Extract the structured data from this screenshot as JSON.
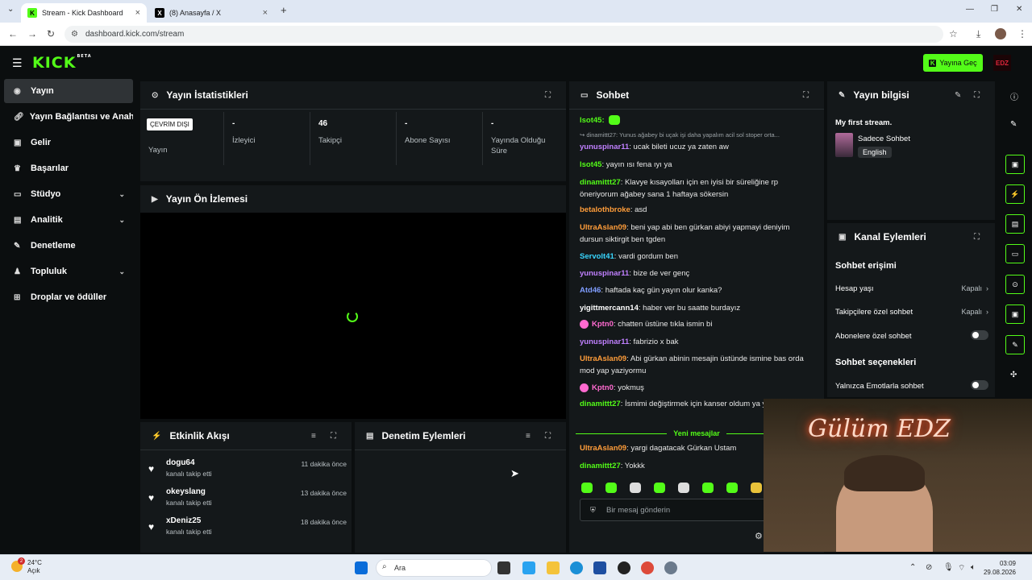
{
  "browser": {
    "tabs": [
      {
        "title": "Stream - Kick Dashboard",
        "active": true
      },
      {
        "title": "(8) Anasayfa / X",
        "active": false
      }
    ],
    "url": "dashboard.kick.com/stream"
  },
  "header": {
    "logo": "KICK",
    "logo_sup": "BETA",
    "go_live_label": "Yayına Geç",
    "avatar_text": "EDZ",
    "accent": "#53fc18"
  },
  "sidebar": {
    "items": [
      {
        "label": "Yayın",
        "icon": "video-icon",
        "active": true
      },
      {
        "label": "Yayın Bağlantısı ve Anahtarı",
        "icon": "link-icon"
      },
      {
        "label": "Gelir",
        "icon": "wallet-icon"
      },
      {
        "label": "Başarılar",
        "icon": "trophy-icon"
      },
      {
        "label": "Stüdyo",
        "icon": "studio-icon",
        "expandable": true
      },
      {
        "label": "Analitik",
        "icon": "chart-icon",
        "expandable": true
      },
      {
        "label": "Denetleme",
        "icon": "wrench-icon"
      },
      {
        "label": "Topluluk",
        "icon": "users-icon",
        "expandable": true
      },
      {
        "label": "Droplar ve ödüller",
        "icon": "gift-icon"
      }
    ]
  },
  "stats": {
    "title": "Yayın İstatistikleri",
    "offline_badge": "ÇEVRİM DIŞI",
    "items": [
      {
        "value": "",
        "label": "Yayın"
      },
      {
        "value": "-",
        "label": "İzleyici"
      },
      {
        "value": "46",
        "label": "Takipçi"
      },
      {
        "value": "-",
        "label": "Abone Sayısı"
      },
      {
        "value": "-",
        "label": "Yayında Olduğu Süre"
      }
    ]
  },
  "preview": {
    "title": "Yayın Ön İzlemesi"
  },
  "activity": {
    "title": "Etkinlik Akışı",
    "items": [
      {
        "user": "dogu64",
        "action": "kanalı takip etti",
        "time": "11 dakika önce"
      },
      {
        "user": "okeyslang",
        "action": "kanalı takip etti",
        "time": "13 dakika önce"
      },
      {
        "user": "xDeniz25",
        "action": "kanalı takip etti",
        "time": "18 dakika önce"
      }
    ]
  },
  "moderation": {
    "title": "Denetim Eylemleri"
  },
  "chat": {
    "title": "Sohbet",
    "top_user": "lsot45:",
    "reply_preview": "↪ dinamittt27: Yunus ağabey bi uçak işi daha yapalım acil sol stoper orta...",
    "messages": [
      {
        "user": "yunuspinar11",
        "color": "#c080ff",
        "text": "ucak bileti ucuz ya zaten aw"
      },
      {
        "user": "lsot45",
        "color": "#53fc18",
        "text": "yayın ısı fena ıyı ya"
      },
      {
        "user": "dinamittt27",
        "color": "#53fc18",
        "text": "Klavye kısayolları için en iyisi bir süreliğine rp öneriyorum ağabey sana 1 haftaya sökersin"
      },
      {
        "user": "betalothbroke",
        "color": "#ff9d3a",
        "text": "asd"
      },
      {
        "user": "UltraAslan09",
        "color": "#ff9d3a",
        "text": "beni yap abi ben gürkan abiyi yapmayi deniyim dursun siktirgit ben tgden"
      },
      {
        "user": "Servolt41",
        "color": "#38d6ff",
        "text": "vardi gordum ben"
      },
      {
        "user": "yunuspinar11",
        "color": "#c080ff",
        "text": "bize de ver genç"
      },
      {
        "user": "Atd46",
        "color": "#7f9dff",
        "text": "haftada kaç gün yayın olur kanka?"
      },
      {
        "user": "yigittmercann14",
        "color": "#ffffff",
        "text": "haber ver bu saatte burdayız"
      },
      {
        "user": "Kptn0",
        "color": "#ff6ad0",
        "text": "chatten üstüne tıkla ismin bi"
      },
      {
        "user": "yunuspinar11",
        "color": "#c080ff",
        "text": "fabrizio x bak"
      },
      {
        "user": "UltraAslan09",
        "color": "#ff9d3a",
        "text": "Abi gürkan abinin mesajin üstünde ismine bas orda mod yap yaziyormu"
      },
      {
        "user": "Kptn0",
        "color": "#ff6ad0",
        "text": "yokmuş"
      },
      {
        "user": "dinamittt27",
        "color": "#53fc18",
        "text": "İsmimi değiştirmek için kanser oldum ya yapamadık ya"
      }
    ],
    "new_divider": "Yeni mesajlar",
    "new_messages": [
      {
        "user": "UltraAslan09",
        "color": "#ff9d3a",
        "text": "yargi dagatacak Gürkan Ustam"
      },
      {
        "user": "dinamittt27",
        "color": "#53fc18",
        "text": "Yokkk"
      }
    ],
    "input_placeholder": "Bir mesaj gönderin"
  },
  "stream_info": {
    "title": "Yayın bilgisi",
    "stream_title": "My first stream.",
    "category": "Sadece Sohbet",
    "language": "English"
  },
  "channel_actions": {
    "title": "Kanal Eylemleri",
    "chat_access": "Sohbet erişimi",
    "account_age": "Hesap yaşı",
    "account_age_value": "Kapalı",
    "followers_only": "Takipçilere özel sohbet",
    "followers_only_value": "Kapalı",
    "subs_only": "Abonelere özel sohbet",
    "chat_options": "Sohbet seçenekleri",
    "emotes_only": "Yalnızca Emotlarla sohbet"
  },
  "webcam": {
    "neon_text": "Gülüm EDZ"
  },
  "taskbar": {
    "temp": "24°C",
    "weather": "Açık",
    "badge": "2",
    "search": "Ara",
    "time": "03:09",
    "date": "29.08.2026"
  }
}
